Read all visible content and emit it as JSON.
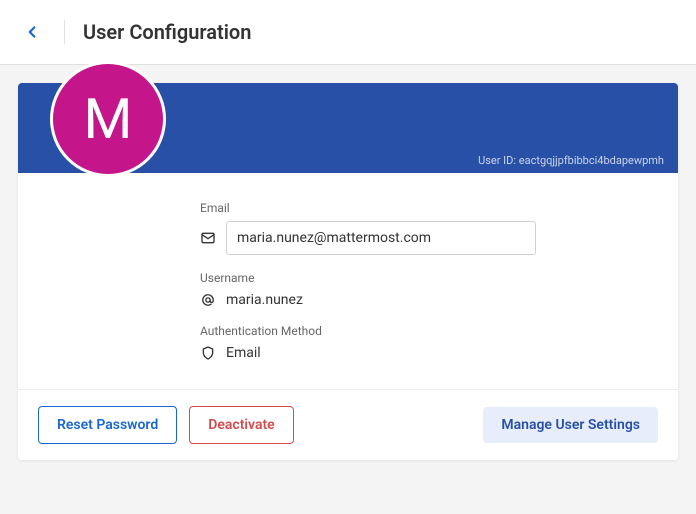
{
  "header": {
    "title": "User Configuration"
  },
  "user": {
    "avatar_letter": "M",
    "user_id_label": "User ID:",
    "user_id": "eactgqjjpfbibbci4bdapewpmh"
  },
  "fields": {
    "email": {
      "label": "Email",
      "value": "maria.nunez@mattermost.com"
    },
    "username": {
      "label": "Username",
      "value": "maria.nunez"
    },
    "auth": {
      "label": "Authentication Method",
      "value": "Email"
    }
  },
  "actions": {
    "reset": "Reset Password",
    "deactivate": "Deactivate",
    "manage": "Manage User Settings"
  }
}
